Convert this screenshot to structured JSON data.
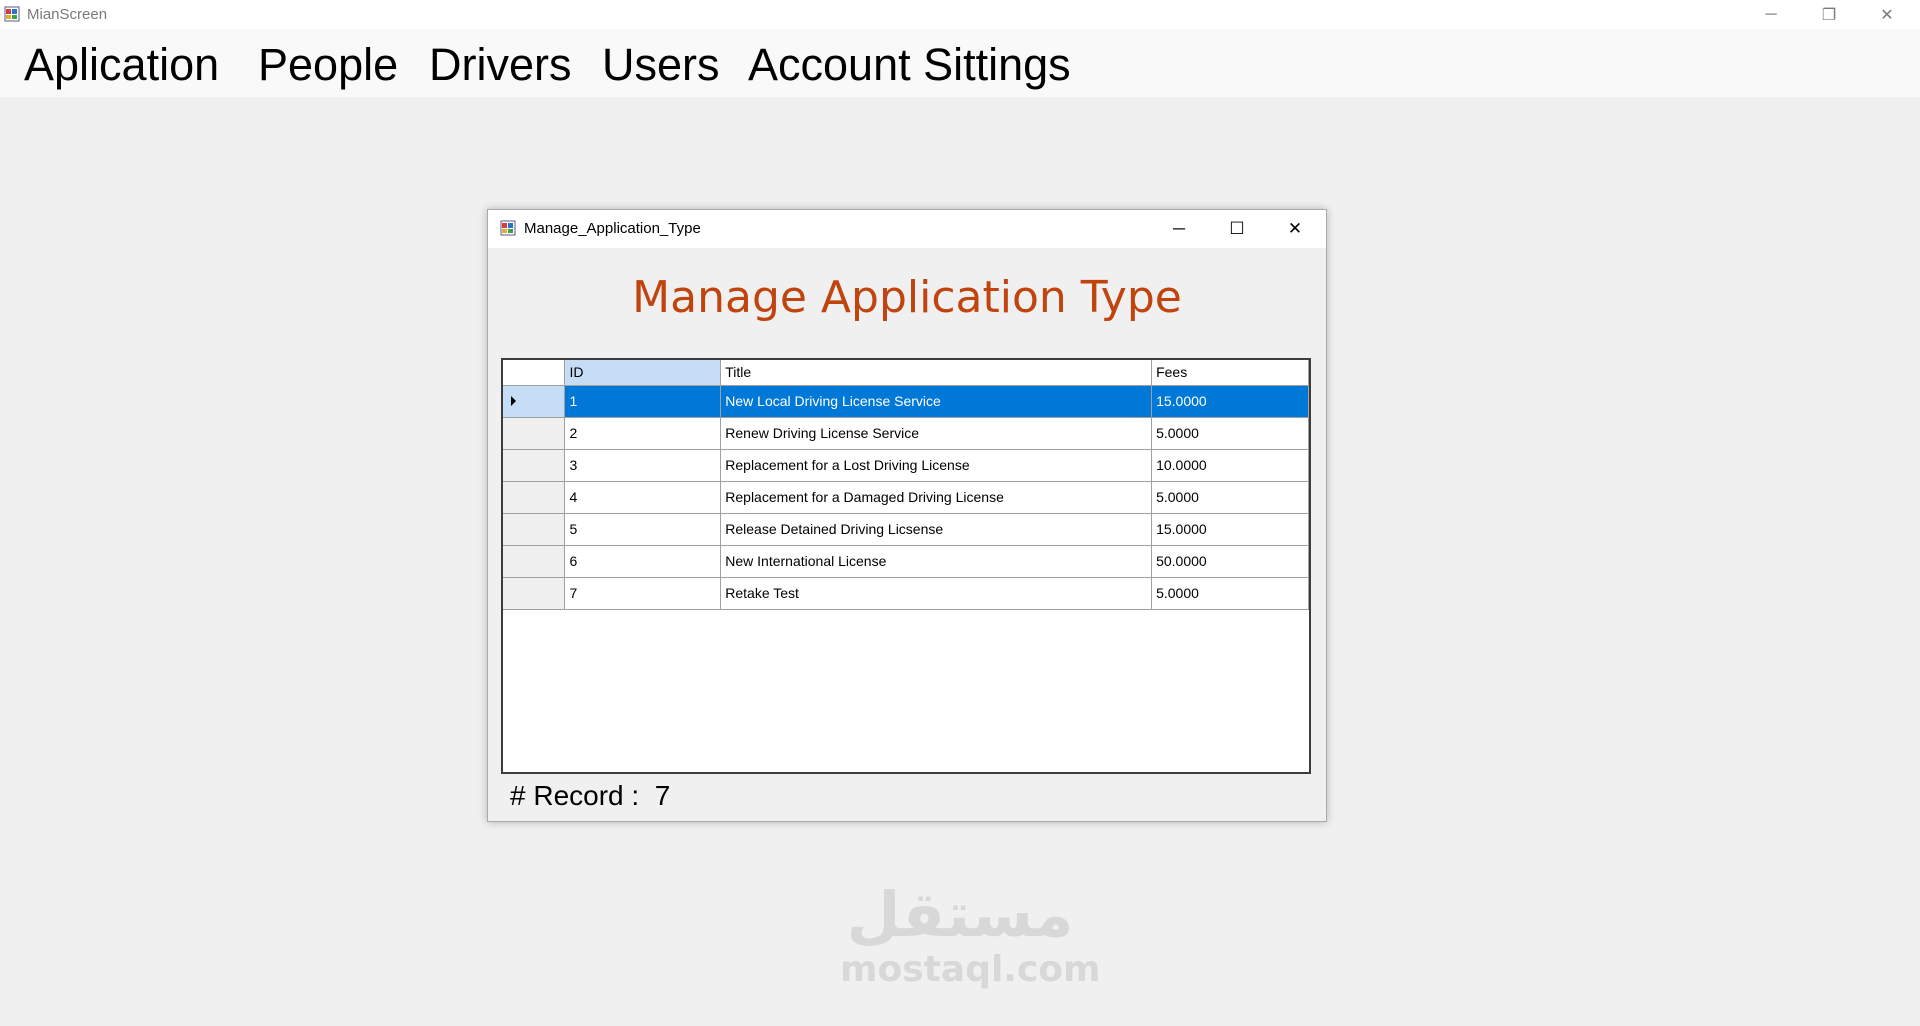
{
  "main_window": {
    "title": "MianScreen",
    "controls": {
      "minimize": "─",
      "restore": "❐",
      "close": "✕"
    }
  },
  "menu": {
    "items": [
      {
        "label": "Aplication"
      },
      {
        "label": "People"
      },
      {
        "label": "Drivers"
      },
      {
        "label": "Users"
      },
      {
        "label": "Account Sittings"
      }
    ]
  },
  "child_window": {
    "title": "Manage_Application_Type",
    "controls": {
      "minimize": "─",
      "maximize": "☐",
      "close": "✕"
    },
    "heading": "Manage Application Type",
    "heading_color": "#c1440e",
    "grid": {
      "columns": [
        "ID",
        "Title",
        "Fees"
      ],
      "selected_row": 0,
      "rows": [
        [
          "1",
          "New Local Driving License Service",
          "15.0000"
        ],
        [
          "2",
          "Renew Driving License Service",
          "5.0000"
        ],
        [
          "3",
          "Replacement for a Lost Driving License",
          "10.0000"
        ],
        [
          "4",
          "Replacement for a Damaged Driving License",
          "5.0000"
        ],
        [
          "5",
          "Release Detained Driving Licsense",
          "15.0000"
        ],
        [
          "6",
          "New International License",
          "50.0000"
        ],
        [
          "7",
          "Retake Test",
          "5.0000"
        ]
      ]
    },
    "records_label": "# Record :",
    "records_count": "7"
  },
  "watermark": {
    "arabic": "مستقل",
    "latin": "mostaql.com"
  }
}
